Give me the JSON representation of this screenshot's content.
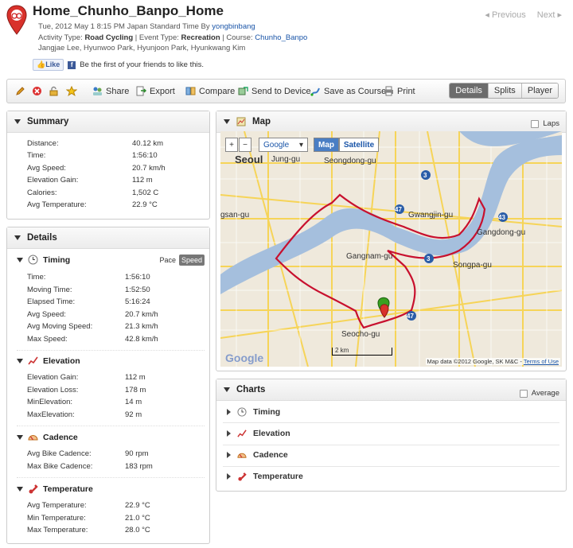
{
  "header": {
    "title": "Home_Chunho_Banpo_Home",
    "date_line": "Tue, 2012 May 1 8:15 PM Japan Standard Time By",
    "author": "yongbinbang",
    "activity_type_label": "Activity Type:",
    "activity_type": "Road Cycling",
    "event_type_label": "| Event Type:",
    "event_type": "Recreation",
    "course_label": "| Course:",
    "course": "Chunho_Banpo",
    "participants": "Jangjae Lee, Hyunwoo Park, Hyunjoon Park, Hyunkwang Kim",
    "previous": "Previous",
    "next": "Next",
    "like_button": "Like",
    "like_text": "Be the first of your friends to like this."
  },
  "toolbar": {
    "share": "Share",
    "export": "Export",
    "compare": "Compare",
    "send": "Send to Device",
    "save_course": "Save as Course",
    "print": "Print",
    "views": [
      "Details",
      "Splits",
      "Player"
    ],
    "active_view": "Details"
  },
  "summary": {
    "title": "Summary",
    "rows": [
      {
        "label": "Distance:",
        "value": "40.12 km"
      },
      {
        "label": "Time:",
        "value": "1:56:10"
      },
      {
        "label": "Avg Speed:",
        "value": "20.7 km/h"
      },
      {
        "label": "Elevation Gain:",
        "value": "112 m"
      },
      {
        "label": "Calories:",
        "value": "1,502 C"
      },
      {
        "label": "Avg Temperature:",
        "value": "22.9 °C"
      }
    ]
  },
  "details": {
    "title": "Details",
    "pace": "Pace",
    "speed": "Speed",
    "timing": {
      "title": "Timing",
      "rows": [
        {
          "label": "Time:",
          "value": "1:56:10"
        },
        {
          "label": "Moving Time:",
          "value": "1:52:50"
        },
        {
          "label": "Elapsed Time:",
          "value": "5:16:24"
        },
        {
          "label": "Avg Speed:",
          "value": "20.7 km/h"
        },
        {
          "label": "Avg Moving Speed:",
          "value": "21.3 km/h"
        },
        {
          "label": "Max Speed:",
          "value": "42.8 km/h"
        }
      ]
    },
    "elevation": {
      "title": "Elevation",
      "rows": [
        {
          "label": "Elevation Gain:",
          "value": "112 m"
        },
        {
          "label": "Elevation Loss:",
          "value": "178 m"
        },
        {
          "label": "MinElevation:",
          "value": "14 m"
        },
        {
          "label": "MaxElevation:",
          "value": "92 m"
        }
      ]
    },
    "cadence": {
      "title": "Cadence",
      "rows": [
        {
          "label": "Avg Bike Cadence:",
          "value": "90 rpm"
        },
        {
          "label": "Max Bike Cadence:",
          "value": "183 rpm"
        }
      ]
    },
    "temperature": {
      "title": "Temperature",
      "rows": [
        {
          "label": "Avg Temperature:",
          "value": "22.9 °C"
        },
        {
          "label": "Min Temperature:",
          "value": "21.0 °C"
        },
        {
          "label": "Max Temperature:",
          "value": "28.0 °C"
        }
      ]
    }
  },
  "map": {
    "title": "Map",
    "laps": "Laps",
    "provider": "Google",
    "map_btn": "Map",
    "satellite_btn": "Satellite",
    "scale": "2 km",
    "attribution": "Map data ©2012 Google, SK M&C",
    "terms": "Terms of Use",
    "labels": {
      "seoul": "Seoul",
      "jung": "Jung-gu",
      "seongdong": "Seongdong-gu",
      "gwangjin": "Gwangjin-gu",
      "gangdong": "Gangdong-gu",
      "gangnam": "Gangnam-gu",
      "songpa": "Songpa-gu",
      "seocho": "Seocho-gu",
      "gasan": "gsan-gu"
    }
  },
  "charts": {
    "title": "Charts",
    "average": "Average",
    "items": [
      "Timing",
      "Elevation",
      "Cadence",
      "Temperature"
    ]
  },
  "colors": {
    "route": "#c8102e",
    "river": "#a5bfdd",
    "link": "#1a55a8"
  }
}
